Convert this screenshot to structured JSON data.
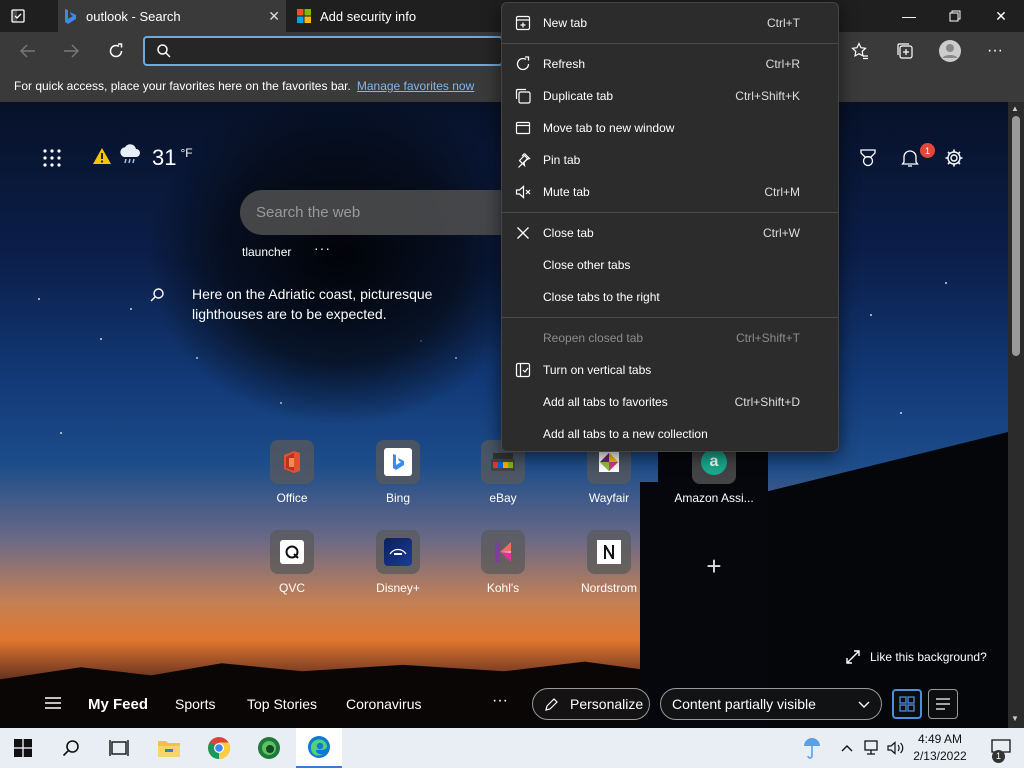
{
  "tabs": [
    {
      "title": "outlook - Search",
      "favicon": "bing-icon"
    },
    {
      "title": "Add security info",
      "favicon": "microsoft-icon"
    }
  ],
  "favorites_bar": {
    "message": "For quick access, place your favorites here on the favorites bar.",
    "link": "Manage favorites now"
  },
  "ntp": {
    "weather": {
      "temp": "31",
      "unit": "°F"
    },
    "notification_count": "1",
    "search_placeholder": "Search the web",
    "quick_link": "tlauncher",
    "quick_more": "···",
    "image_fact": "Here on the Adriatic coast, picturesque lighthouses are to be expected.",
    "tiles": [
      {
        "label": "Office"
      },
      {
        "label": "Bing"
      },
      {
        "label": "eBay"
      },
      {
        "label": "Wayfair"
      },
      {
        "label": "Amazon Assi..."
      },
      {
        "label": "QVC"
      },
      {
        "label": "Disney+"
      },
      {
        "label": "Kohl's"
      },
      {
        "label": "Nordstrom"
      }
    ],
    "add_tile": "+",
    "like_background": "Like this background?",
    "feed": {
      "tabs": [
        "My Feed",
        "Sports",
        "Top Stories",
        "Coronavirus"
      ],
      "more": "···",
      "personalize": "Personalize",
      "content_setting": "Content partially visible"
    }
  },
  "context_menu": [
    {
      "label": "New tab",
      "shortcut": "Ctrl+T",
      "icon": "new-tab-icon",
      "disabled": false
    },
    {
      "label": "Refresh",
      "shortcut": "Ctrl+R",
      "icon": "refresh-icon",
      "disabled": false
    },
    {
      "label": "Duplicate tab",
      "shortcut": "Ctrl+Shift+K",
      "icon": "duplicate-icon",
      "disabled": false
    },
    {
      "label": "Move tab to new window",
      "shortcut": "",
      "icon": "window-icon",
      "disabled": false
    },
    {
      "label": "Pin tab",
      "shortcut": "",
      "icon": "pin-icon",
      "disabled": false
    },
    {
      "label": "Mute tab",
      "shortcut": "Ctrl+M",
      "icon": "mute-icon",
      "disabled": false
    },
    {
      "label": "Close tab",
      "shortcut": "Ctrl+W",
      "icon": "close-icon",
      "disabled": false
    },
    {
      "label": "Close other tabs",
      "shortcut": "",
      "icon": "",
      "disabled": false
    },
    {
      "label": "Close tabs to the right",
      "shortcut": "",
      "icon": "",
      "disabled": false
    },
    {
      "label": "Reopen closed tab",
      "shortcut": "Ctrl+Shift+T",
      "icon": "",
      "disabled": true
    },
    {
      "label": "Turn on vertical tabs",
      "shortcut": "",
      "icon": "vertical-tabs-icon",
      "disabled": false
    },
    {
      "label": "Add all tabs to favorites",
      "shortcut": "Ctrl+Shift+D",
      "icon": "",
      "disabled": false
    },
    {
      "label": "Add all tabs to a new collection",
      "shortcut": "",
      "icon": "",
      "disabled": false
    }
  ],
  "taskbar": {
    "time": "4:49 AM",
    "date": "2/13/2022",
    "notifications": "1"
  },
  "colors": {
    "accent": "#4a8fe0",
    "link": "#7db8ef",
    "badge": "#e3463a"
  }
}
